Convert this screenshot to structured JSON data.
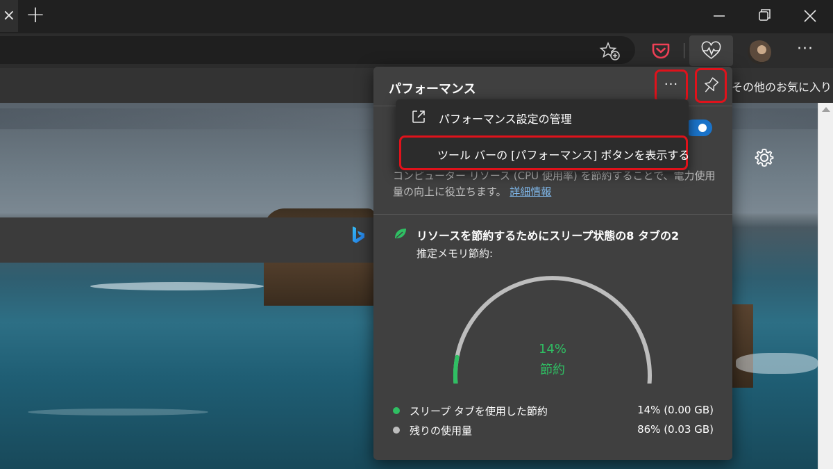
{
  "titlebar": {
    "tab_close_glyph": "×",
    "new_tab_glyph": "+"
  },
  "toolbar": {
    "more_glyph": "···"
  },
  "favorites_bar": {
    "other_favorites": "その他のお気に入り"
  },
  "performance_panel": {
    "title": "パフォーマンス",
    "more_glyph": "···",
    "description": "コンピューター リソース (CPU 使用率) を節約することで、電力使用量の向上に役立ちます。",
    "learn_more": "詳細情報",
    "sleeping_heading": "リソースを節約するためにスリープ状態の8 タブの2",
    "memory_label": "推定メモリ節約:",
    "gauge": {
      "percent_text": "14%",
      "saved_label": "節約",
      "saved_fraction": 0.14
    },
    "legend": [
      {
        "label": "スリープ タブを使用した節約",
        "value": "14% (0.00 GB)",
        "color": "#2fbf63"
      },
      {
        "label": "残りの使用量",
        "value": "86% (0.03 GB)",
        "color": "#bdbdbd"
      }
    ],
    "toggle_on": true
  },
  "context_menu": {
    "manage_settings": "パフォーマンス設定の管理",
    "show_toolbar_button": "ツール バーの [パフォーマンス] ボタンを表示する"
  },
  "colors": {
    "accent_red": "#e0121b",
    "gauge_green": "#2fbf63",
    "gauge_gray": "#bdbdbd",
    "toggle_blue": "#1a73c9"
  }
}
